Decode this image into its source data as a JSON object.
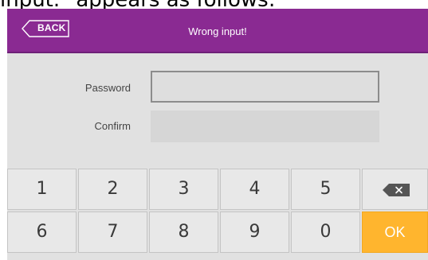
{
  "caption": "input.\" appears as follows:",
  "header": {
    "back_label": "BACK",
    "title": "Wrong input!"
  },
  "form": {
    "password_label": "Password",
    "confirm_label": "Confirm",
    "password_value": "",
    "confirm_value": ""
  },
  "keypad": {
    "row1": [
      "1",
      "2",
      "3",
      "4",
      "5"
    ],
    "row2": [
      "6",
      "7",
      "8",
      "9",
      "0"
    ],
    "ok_label": "OK",
    "backspace_icon": "backspace-icon"
  },
  "colors": {
    "header": "#8a2a92",
    "ok_key": "#ffb52e",
    "background": "#e1e1e1"
  }
}
